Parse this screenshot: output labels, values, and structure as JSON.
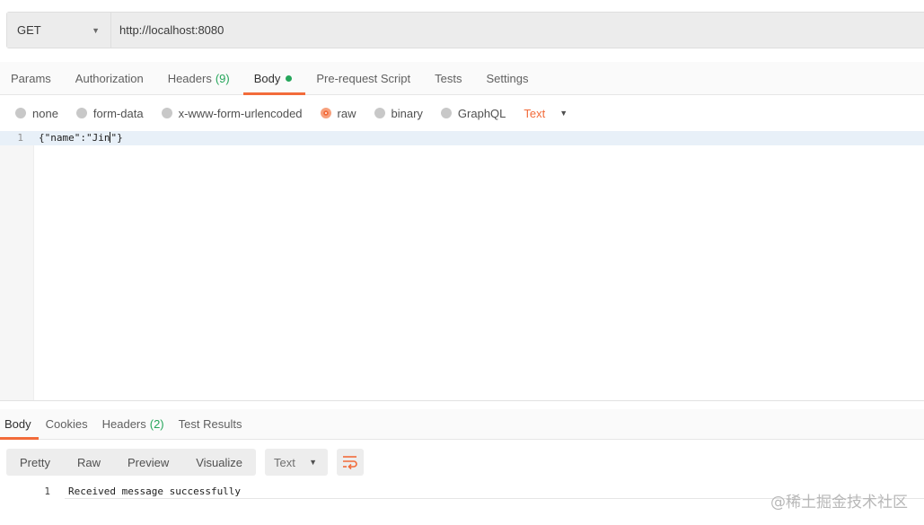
{
  "request": {
    "method": "GET",
    "url": "http://localhost:8080"
  },
  "request_tabs": [
    {
      "label": "Params"
    },
    {
      "label": "Authorization"
    },
    {
      "label": "Headers",
      "count": "(9)"
    },
    {
      "label": "Body"
    },
    {
      "label": "Pre-request Script"
    },
    {
      "label": "Tests"
    },
    {
      "label": "Settings"
    }
  ],
  "body_types": {
    "none": "none",
    "form_data": "form-data",
    "urlencoded": "x-www-form-urlencoded",
    "raw": "raw",
    "binary": "binary",
    "graphql": "GraphQL",
    "format": "Text"
  },
  "editor": {
    "line_number": "1",
    "code_before_cursor": "{\"name\":\"Jin",
    "code_after_cursor": "\"}"
  },
  "response_tabs": [
    {
      "label": "Body"
    },
    {
      "label": "Cookies"
    },
    {
      "label": "Headers",
      "count": "(2)"
    },
    {
      "label": "Test Results"
    }
  ],
  "response_toolbar": {
    "pretty": "Pretty",
    "raw": "Raw",
    "preview": "Preview",
    "visualize": "Visualize",
    "format": "Text",
    "wrap_icon": "wrap-lines-icon"
  },
  "response_body": {
    "line_number": "1",
    "text": "Received message successfully"
  },
  "watermark": "@稀土掘金技术社区",
  "colors": {
    "accent": "#f26b3a",
    "count_green": "#26a65b"
  }
}
